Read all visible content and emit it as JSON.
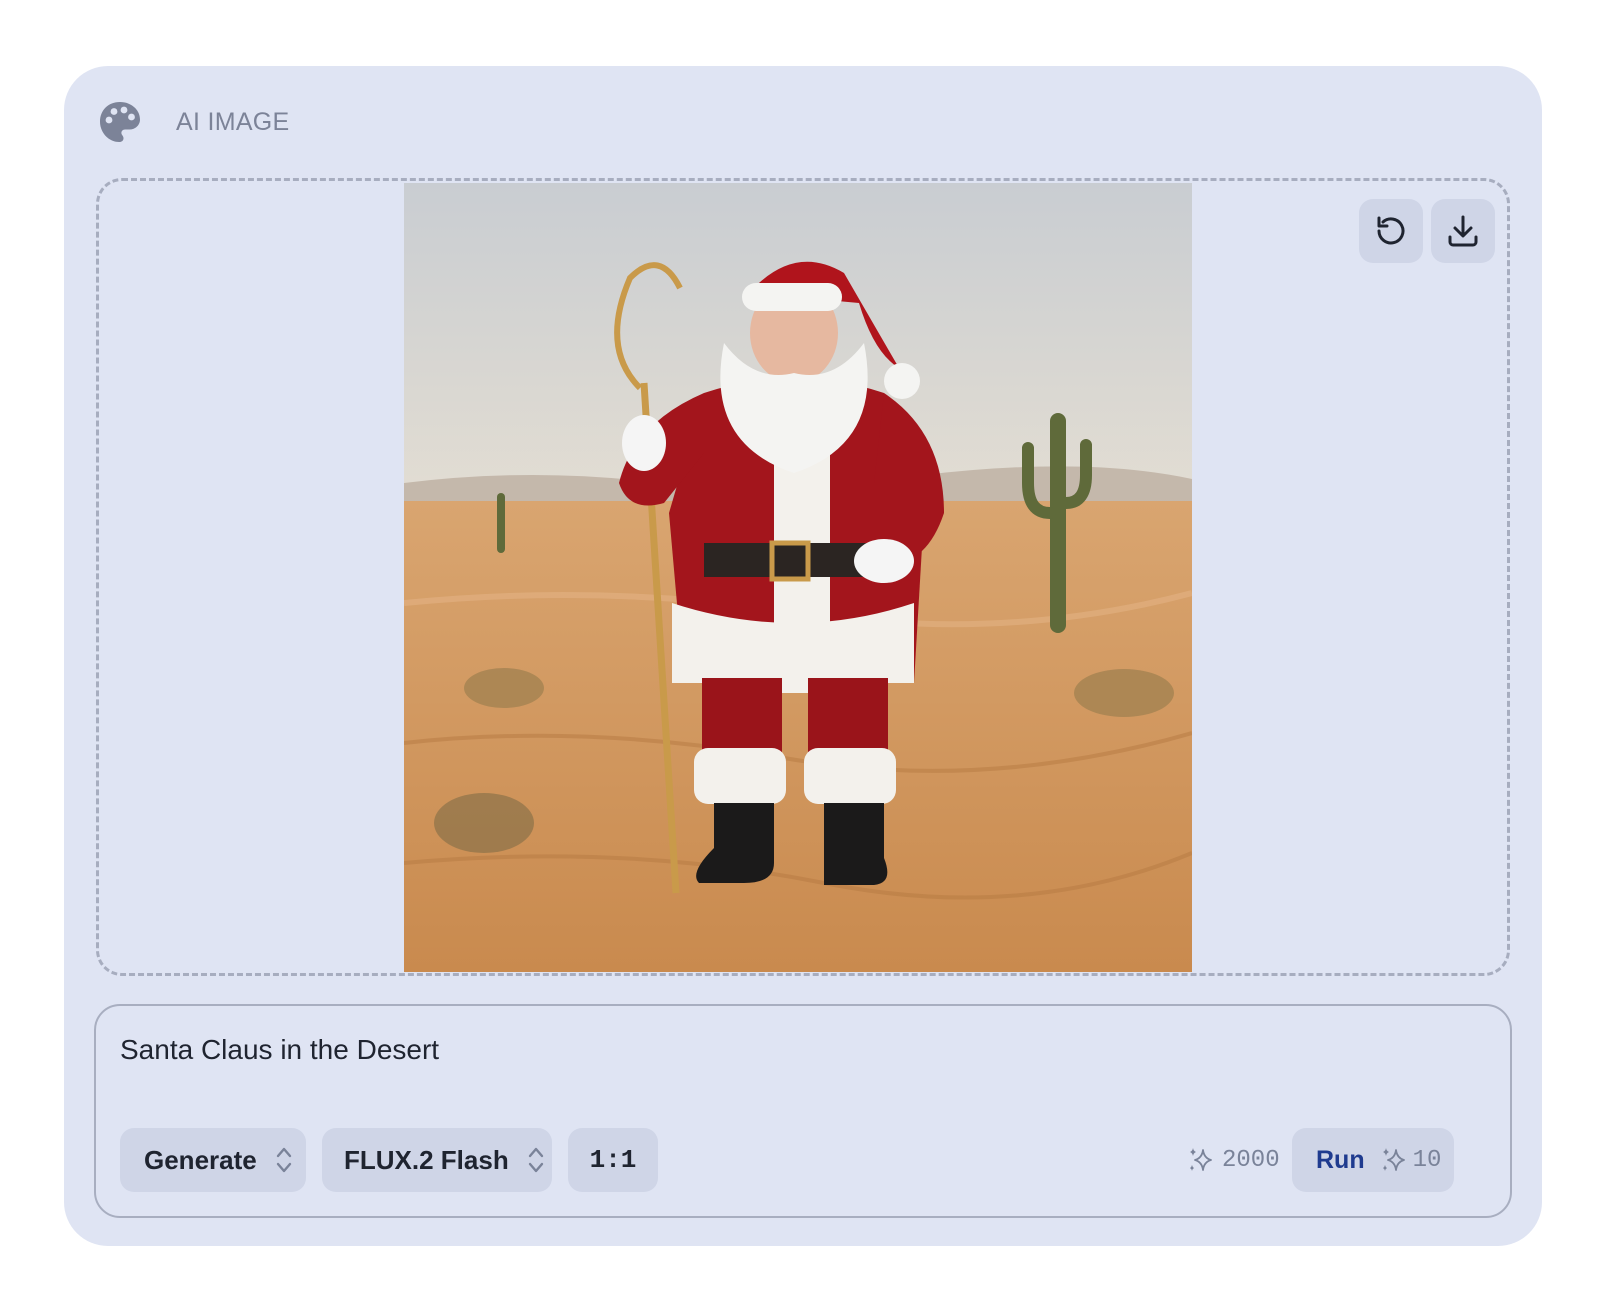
{
  "header": {
    "title": "AI IMAGE",
    "icon": "palette-icon"
  },
  "preview": {
    "toolbar": {
      "reload_icon": "rotate-ccw-icon",
      "download_icon": "download-icon"
    },
    "image_alt": "Santa Claus in the Desert"
  },
  "prompt": {
    "value": "Santa Claus in the Desert"
  },
  "controls": {
    "mode": "Generate",
    "model": "FLUX.2 Flash",
    "aspect_ratio": "1:1",
    "credits_balance": "2000",
    "run_label": "Run",
    "run_cost": "10"
  },
  "colors": {
    "card_bg": "#dfe4f3",
    "chip_bg": "#cfd5e7",
    "run_text": "#1f3b8f",
    "muted_text": "#7a8399"
  }
}
